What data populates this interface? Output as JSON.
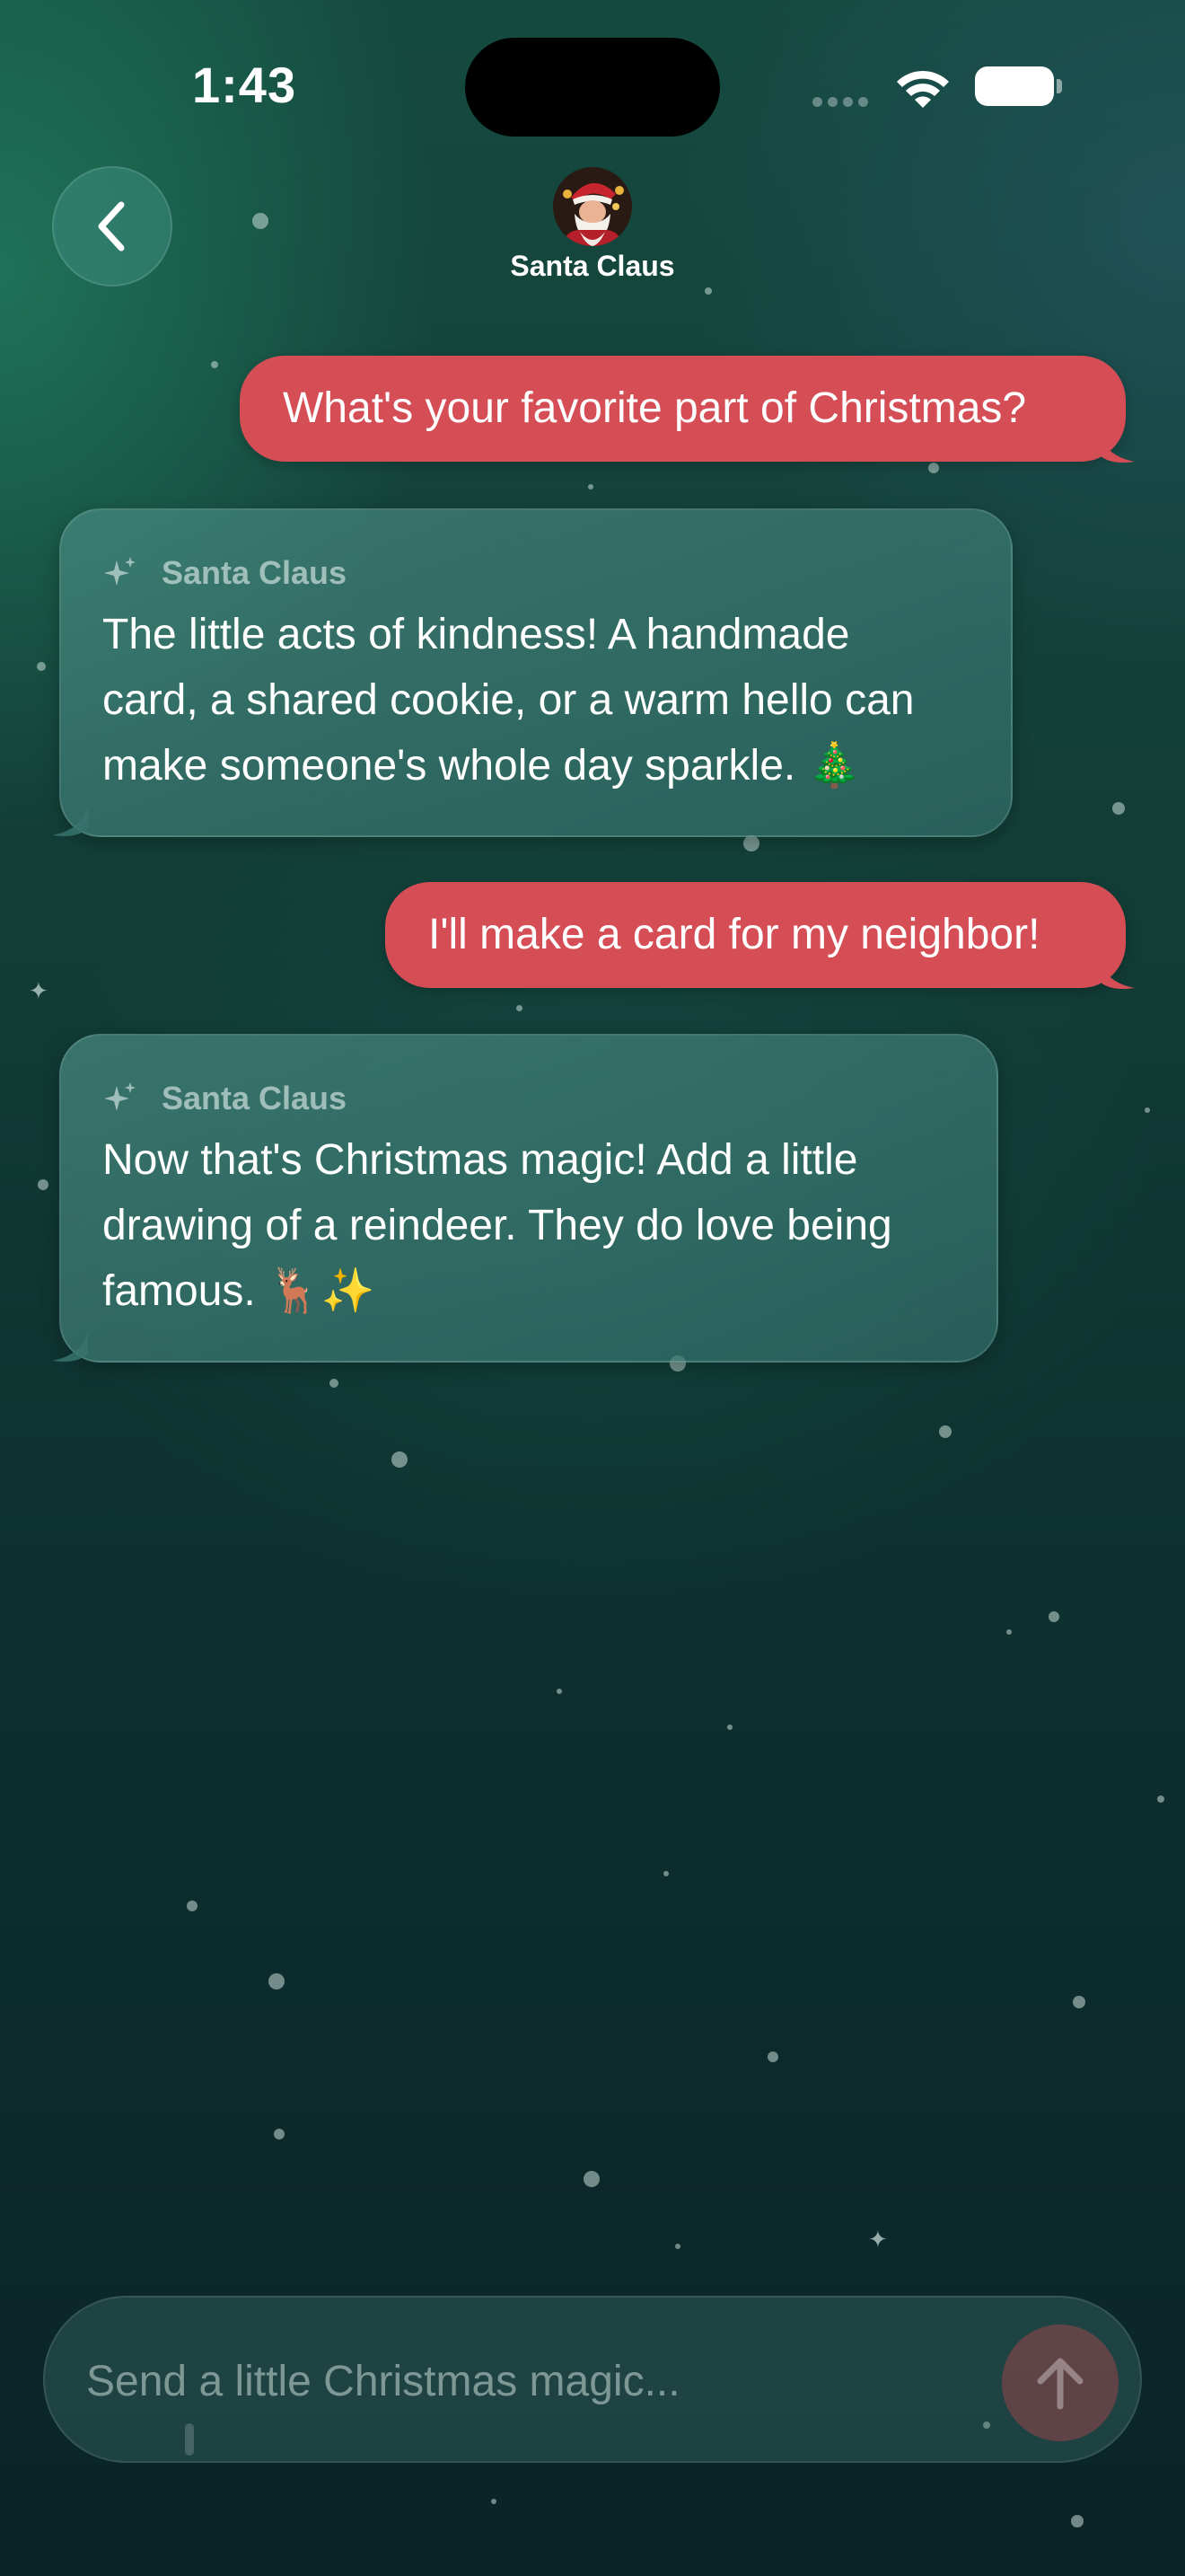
{
  "status_bar": {
    "time": "1:43"
  },
  "header": {
    "back_icon": "chevron-left-icon",
    "contact_name": "Santa Claus"
  },
  "messages": [
    {
      "role": "user",
      "text": "What's your favorite part of Christmas?"
    },
    {
      "role": "bot",
      "sender": "Santa Claus",
      "icon": "sparkles-icon",
      "lines": [
        "The little acts of kindness! A handmade",
        "card, a shared cookie, or a warm hello can",
        "make someone's whole day sparkle. 🎄"
      ]
    },
    {
      "role": "user",
      "text": "I'll make a card for my neighbor!"
    },
    {
      "role": "bot",
      "sender": "Santa Claus",
      "icon": "sparkles-icon",
      "lines": [
        "Now that's Christmas magic! Add a little",
        "drawing of a reindeer. They do love being",
        "famous. 🦌✨"
      ]
    }
  ],
  "composer": {
    "placeholder": "Send a little Christmas magic...",
    "value": "",
    "send_icon": "arrow-up-icon"
  },
  "colors": {
    "user_bubble": "#d54d55",
    "bot_bubble": "#3f8478",
    "background_top": "#154a3f",
    "background_bottom": "#0a2427"
  }
}
